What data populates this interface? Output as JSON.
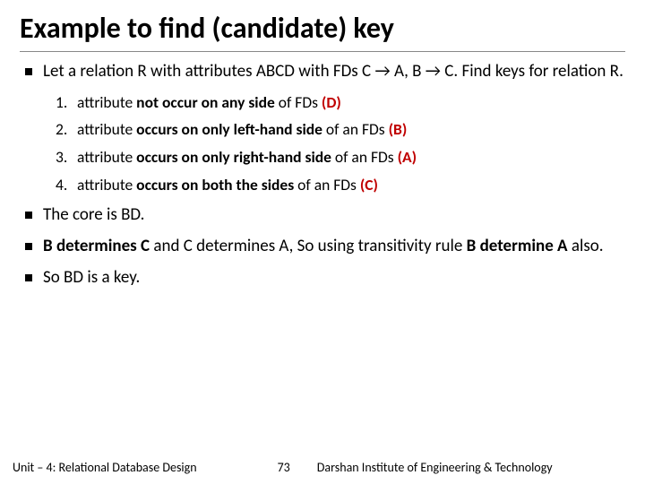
{
  "title": "Example to find (candidate) key",
  "bullets": {
    "b1_pre": "Let a relation R with attributes ABCD with FDs C → A, B → C. Find keys for relation R.",
    "b2_pre": "The core is BD.",
    "b3_a": "B determines C",
    "b3_b": " and C determines A, So using transitivity rule ",
    "b3_c": "B determine A",
    "b3_d": " also.",
    "b4": "So BD is a key."
  },
  "list": [
    {
      "n": "1.",
      "pre": "attribute ",
      "bold": "not occur on any side",
      "post": " of FDs ",
      "accent": "(D)"
    },
    {
      "n": "2.",
      "pre": "attribute ",
      "bold": "occurs on only left-hand side",
      "post": " of an FDs ",
      "accent": "(B)"
    },
    {
      "n": "3.",
      "pre": "attribute ",
      "bold": "occurs on only right-hand side",
      "post": " of an FDs ",
      "accent": "(A)"
    },
    {
      "n": "4.",
      "pre": "attribute ",
      "bold": "occurs on both the sides",
      "post": " of an FDs ",
      "accent": "(C)"
    }
  ],
  "footer": {
    "left": "Unit – 4: Relational Database Design",
    "center": "73",
    "right": "Darshan Institute of Engineering & Technology"
  }
}
